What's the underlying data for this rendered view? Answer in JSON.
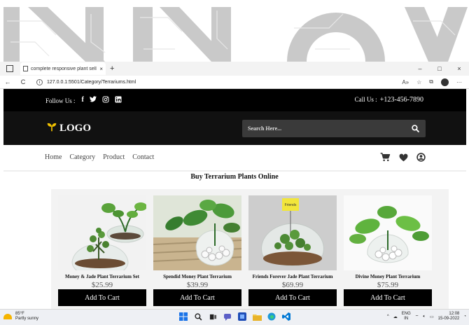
{
  "browser": {
    "tab_title": "complete responsive plant selling…",
    "tab_close": "×",
    "new_tab": "+",
    "window_controls": [
      "–",
      "□",
      "×"
    ],
    "url": "127.0.0.1:5501/Category/Terrariums.html",
    "back": "←",
    "reload": "C",
    "more": "···"
  },
  "site": {
    "follow_label": "Follow Us :",
    "social": [
      "f",
      "t",
      "ig",
      "in"
    ],
    "call_label": "Call Us :",
    "phone": "+123-456-7890",
    "logo_text": "LOGO",
    "search_placeholder": "Search Here...",
    "nav": [
      "Home",
      "Category",
      "Product",
      "Contact"
    ],
    "nav_icons": [
      "cart-icon",
      "heart-icon",
      "user-icon"
    ],
    "heading": "Buy Terrarium Plants Online"
  },
  "products": [
    {
      "name": "Money & Jade Plant Terrarium Set",
      "price": "$25.99",
      "button": "Add To Cart"
    },
    {
      "name": "Spendid Money Plant Terrarium",
      "price": "$39.99",
      "button": "Add To Cart"
    },
    {
      "name": "Friends Forever Jade Plant Terrarium",
      "price": "$69.99",
      "button": "Add To Cart"
    },
    {
      "name": "Divine Money Plant Terrarium",
      "price": "$75.99",
      "button": "Add To Cart"
    }
  ],
  "taskbar": {
    "temp": "85°F",
    "weather": "Partly sunny",
    "lang_top": "ENG",
    "lang_bottom": "IN",
    "time": "12:08",
    "date": "15-09-2022"
  },
  "colors": {
    "accent_leaf": "#f2c200",
    "topbar": "#000000",
    "button": "#000000"
  }
}
